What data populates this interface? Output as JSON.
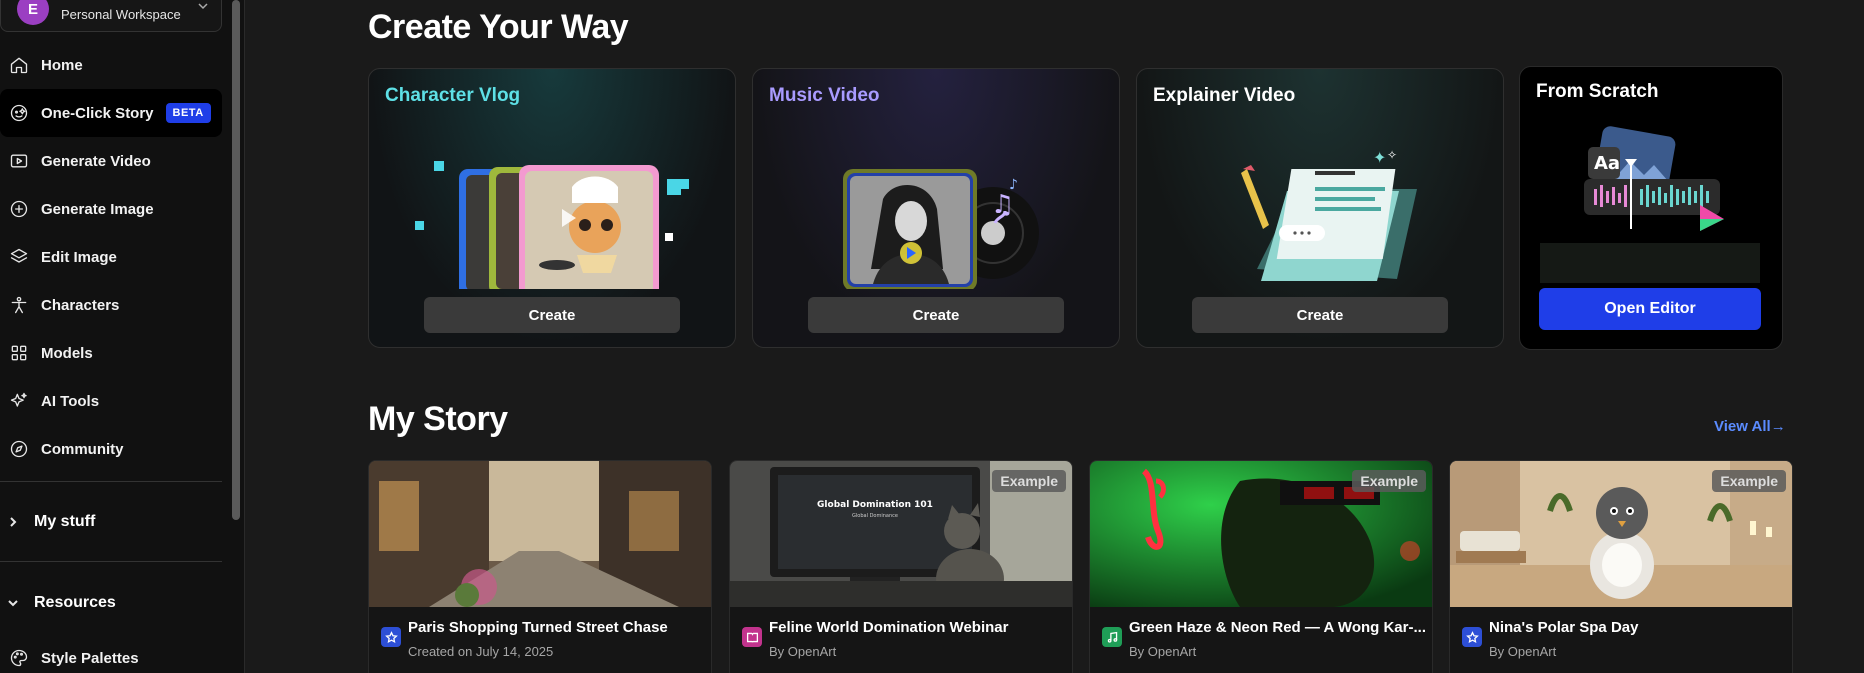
{
  "workspace": {
    "avatar_letter": "E",
    "label": "Personal Workspace"
  },
  "sidebar": {
    "items": [
      {
        "label": "Home",
        "icon": "home-icon"
      },
      {
        "label": "One-Click Story",
        "icon": "sparkle-face-icon",
        "badge": "BETA",
        "active": true
      },
      {
        "label": "Generate Video",
        "icon": "video-icon"
      },
      {
        "label": "Generate Image",
        "icon": "plus-circle-icon"
      },
      {
        "label": "Edit Image",
        "icon": "layers-icon"
      },
      {
        "label": "Characters",
        "icon": "person-icon"
      },
      {
        "label": "Models",
        "icon": "grid-icon"
      },
      {
        "label": "AI Tools",
        "icon": "sparkles-icon"
      },
      {
        "label": "Community",
        "icon": "compass-icon"
      }
    ],
    "sections": [
      {
        "label": "My stuff",
        "expanded": false
      },
      {
        "label": "Resources",
        "expanded": true
      }
    ],
    "resources": [
      {
        "label": "Style Palettes",
        "icon": "palette-icon"
      }
    ]
  },
  "create": {
    "title": "Create Your Way",
    "cards": [
      {
        "title": "Character Vlog",
        "title_color": "#5ee0e6",
        "button": "Create"
      },
      {
        "title": "Music Video",
        "title_color": "#a99bff",
        "button": "Create"
      },
      {
        "title": "Explainer Video",
        "title_color": "#ffffff",
        "button": "Create"
      }
    ],
    "scratch": {
      "title": "From Scratch",
      "button": "Open Editor",
      "art_text": "Aa"
    }
  },
  "story": {
    "title": "My Story",
    "view_all": "View All",
    "cards": [
      {
        "title": "Paris Shopping Turned Street Chase",
        "meta": "Created on July 14, 2025",
        "icon": "star-icon",
        "icon_color": "#2d4fd6",
        "example": false
      },
      {
        "title": "Feline World Domination Webinar",
        "meta": "By OpenArt",
        "icon": "book-icon",
        "icon_color": "#c2338d",
        "example": true,
        "example_label": "Example",
        "screen_title": "Global Domination 101",
        "screen_sub": "Global Dominance"
      },
      {
        "title": "Green Haze & Neon Red — A Wong Kar-...",
        "meta": "By OpenArt",
        "icon": "music-icon",
        "icon_color": "#1f9e57",
        "example": true,
        "example_label": "Example"
      },
      {
        "title": "Nina's Polar Spa Day",
        "meta": "By OpenArt",
        "icon": "star-icon",
        "icon_color": "#2d4fd6",
        "example": true,
        "example_label": "Example"
      }
    ]
  }
}
